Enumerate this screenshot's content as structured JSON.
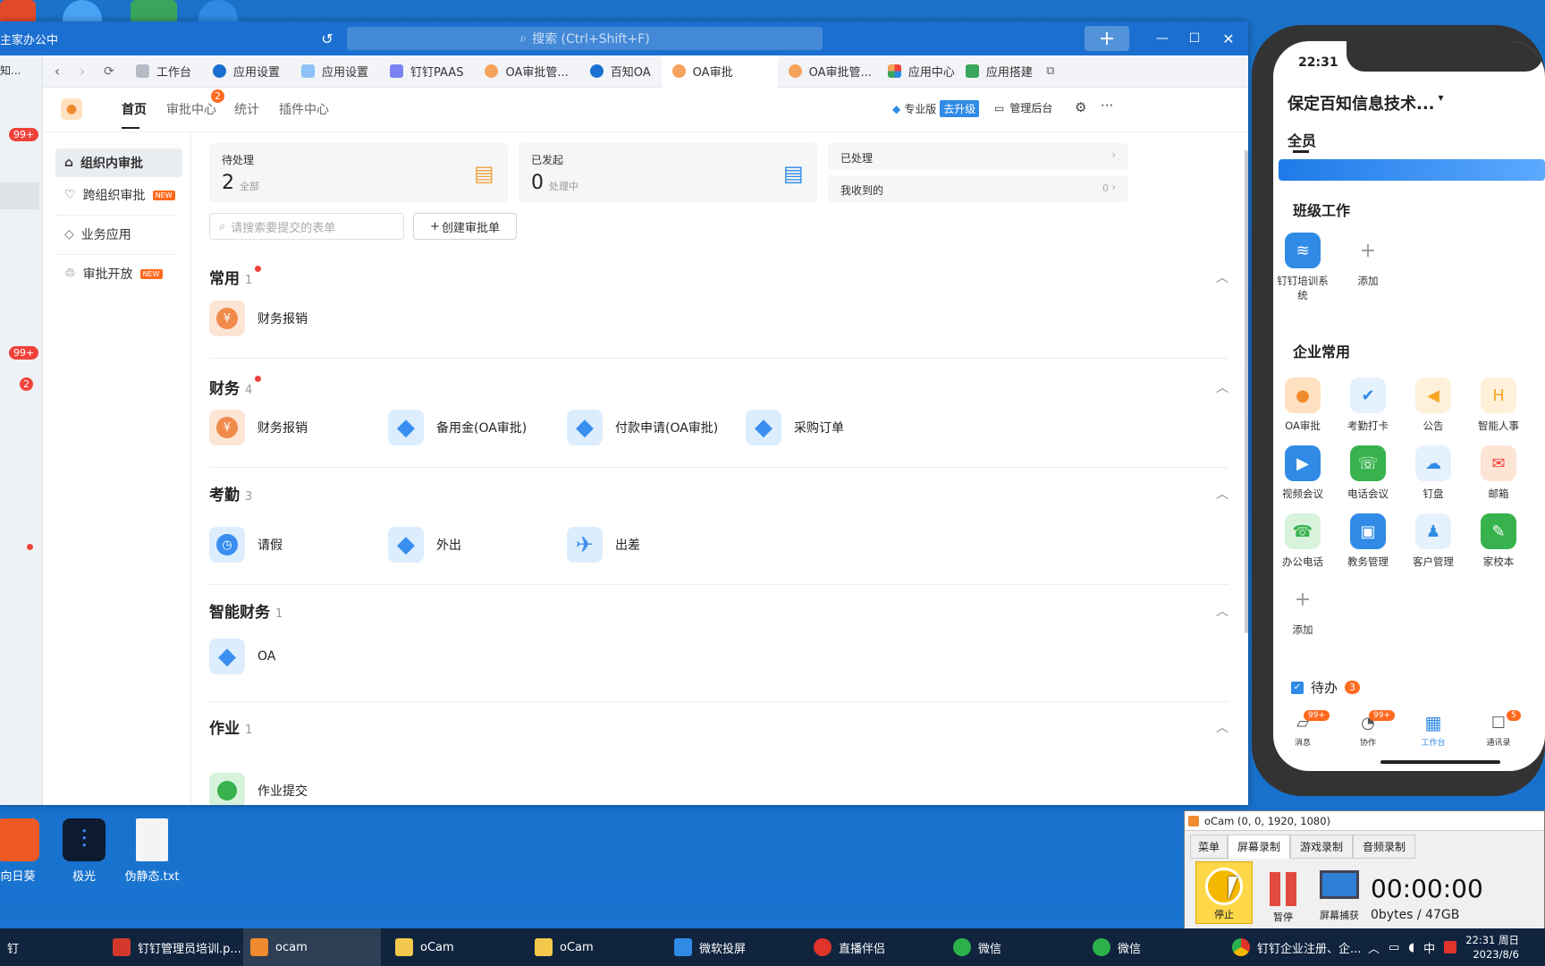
{
  "colors": {
    "accent": "#1a6fd0",
    "badge": "#f0423b",
    "new": "#ff6a1f"
  },
  "titlebar": {
    "title": "主家办公中",
    "search_placeholder": "搜索 (Ctrl+Shift+F)"
  },
  "left_strip": {
    "label": "知...",
    "badge1": "99+",
    "badge2": "99+",
    "badge3": "2"
  },
  "tabs": [
    {
      "label": "工作台",
      "icon": "workbench-icon"
    },
    {
      "label": "应用设置",
      "icon": "settings-app-icon"
    },
    {
      "label": "应用设置",
      "icon": "settings-app-icon"
    },
    {
      "label": "钉钉PAAS",
      "icon": "paas-icon"
    },
    {
      "label": "OA审批管...",
      "icon": "oa-icon"
    },
    {
      "label": "百知OA",
      "icon": "oa-icon"
    },
    {
      "label": "OA审批",
      "icon": "oa-icon"
    },
    {
      "label": "OA审批管...",
      "icon": "oa-icon"
    },
    {
      "label": "应用中心",
      "icon": "app-center-icon"
    },
    {
      "label": "应用搭建",
      "icon": "app-build-icon"
    }
  ],
  "app_header": {
    "nav": [
      "首页",
      "审批中心",
      "统计",
      "插件中心"
    ],
    "approval_badge": "2",
    "pro_label": "专业版",
    "upgrade_label": "去升级",
    "admin_label": "管理后台"
  },
  "sidenav": [
    {
      "label": "组织内审批",
      "new": ""
    },
    {
      "label": "跨组织审批",
      "new": "NEW"
    },
    {
      "label": "业务应用",
      "new": ""
    },
    {
      "label": "审批开放",
      "new": "NEW"
    }
  ],
  "summary": {
    "pending": {
      "label": "待处理",
      "count": "2",
      "sub": "全部"
    },
    "initiated": {
      "label": "已发起",
      "count": "0",
      "sub": "处理中"
    },
    "handled": {
      "label": "已处理"
    },
    "received": {
      "label": "我收到的",
      "count": "0"
    }
  },
  "form_search": {
    "placeholder": "请搜索要提交的表单",
    "create_label": "创建审批单"
  },
  "sections": [
    {
      "title": "常用",
      "count": "1",
      "items": [
        "财务报销"
      ]
    },
    {
      "title": "财务",
      "count": "4",
      "items": [
        "财务报销",
        "备用金(OA审批)",
        "付款申请(OA审批)",
        "采购订单"
      ]
    },
    {
      "title": "考勤",
      "count": "3",
      "items": [
        "请假",
        "外出",
        "出差"
      ]
    },
    {
      "title": "智能财务",
      "count": "1",
      "items": [
        "OA"
      ]
    },
    {
      "title": "作业",
      "count": "1",
      "items": [
        "作业提交"
      ]
    }
  ],
  "desktop_icons": [
    {
      "label": "向日葵"
    },
    {
      "label": "极光"
    },
    {
      "label": "伪静态.txt"
    }
  ],
  "phone": {
    "time": "22:31",
    "org": "保定百知信息技术...",
    "tab": "全员",
    "class_work": {
      "title": "班级工作",
      "apps": [
        "钉钉培训系统",
        "添加"
      ]
    },
    "enterprise": {
      "title": "企业常用",
      "apps": [
        "OA审批",
        "考勤打卡",
        "公告",
        "智能人事",
        "视频会议",
        "电话会议",
        "钉盘",
        "邮箱",
        "办公电话",
        "教务管理",
        "客户管理",
        "家校本",
        "添加"
      ]
    },
    "todo": {
      "label": "待办",
      "count": "3"
    },
    "bottom": [
      {
        "label": "消息",
        "badge": "99+"
      },
      {
        "label": "协作",
        "badge": "99+"
      },
      {
        "label": "工作台",
        "badge": ""
      },
      {
        "label": "通讯录",
        "badge": "5"
      }
    ]
  },
  "ocam": {
    "title": "oCam (0, 0, 1920, 1080)",
    "tabs": [
      "菜单",
      "屏幕录制",
      "游戏录制",
      "音频录制"
    ],
    "buttons": [
      "停止",
      "暂停",
      "屏幕捕获"
    ],
    "timer": "00:00:00",
    "size": "0bytes / 47GB"
  },
  "taskbar": {
    "items": [
      {
        "label": "钉"
      },
      {
        "label": "钉钉管理员培训.p..."
      },
      {
        "label": "ocam"
      },
      {
        "label": "oCam"
      },
      {
        "label": "oCam"
      },
      {
        "label": "微软投屏"
      },
      {
        "label": "直播伴侣"
      },
      {
        "label": "微信"
      },
      {
        "label": "微信"
      },
      {
        "label": "钉钉企业注册、企..."
      }
    ],
    "ime": "中",
    "time": "22:31 周日",
    "date": "2023/8/6"
  }
}
